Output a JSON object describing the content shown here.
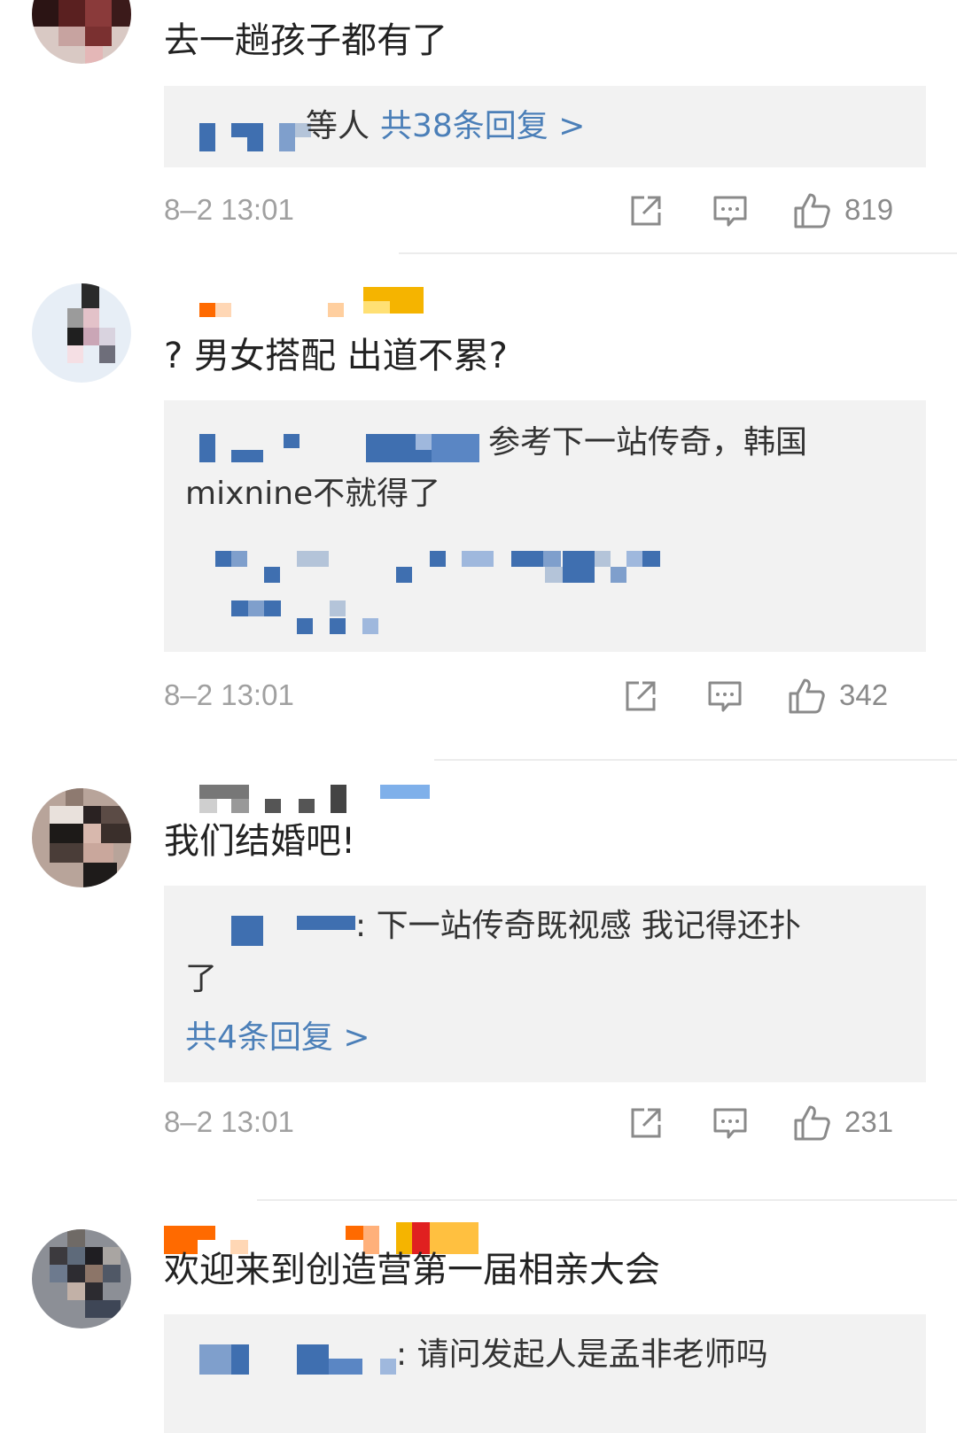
{
  "colors": {
    "text": "#222222",
    "reply_bg": "#f2f2f2",
    "link_blue": "#4b7fb8",
    "meta_gray": "#a0a0a0",
    "mosaic_blue": "#3f6fb0",
    "mosaic_orange": "#ff6a00",
    "mosaic_gold": "#f5b400"
  },
  "comments": [
    {
      "text": "去一趟孩子都有了",
      "reply": {
        "partial_name": "等人",
        "more": "共38条回复 >"
      },
      "timestamp": "8–2 13:01",
      "likes": "819"
    },
    {
      "text": "? 男女搭配 出道不累?",
      "reply": {
        "line1": "参考下一站传奇，韩国",
        "line2": "mixnine不就得了"
      },
      "timestamp": "8–2 13:01",
      "likes": "342"
    },
    {
      "text": "我们结婚吧!",
      "reply": {
        "line1": ": 下一站传奇既视感 我记得还扑",
        "line2": "了",
        "more": "共4条回复 >"
      },
      "timestamp": "8–2 13:01",
      "likes": "231"
    },
    {
      "text": "欢迎来到创造营第一届相亲大会",
      "reply": {
        "line1": ": 请问发起人是孟非老师吗"
      }
    }
  ],
  "icons": {
    "share": "share-icon",
    "comment": "comment-icon",
    "like": "thumbs-up-icon"
  }
}
